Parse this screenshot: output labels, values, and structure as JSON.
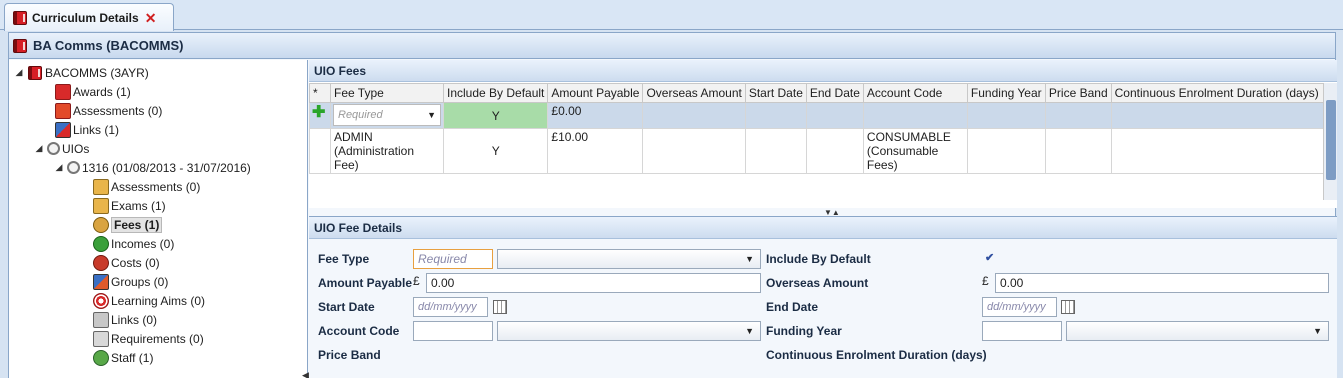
{
  "tab": {
    "title": "Curriculum Details",
    "close": "✕"
  },
  "header": {
    "title": "BA Comms (BACOMMS)"
  },
  "tree": {
    "root": "BACOMMS (3AYR)",
    "awards": "Awards (1)",
    "assessments": "Assessments (0)",
    "links": "Links (1)",
    "uios": "UIOs",
    "uio": "1316 (01/08/2013 - 31/07/2016)",
    "uio_children": [
      {
        "label": "Assessments (0)",
        "icon": "assessments-icon"
      },
      {
        "label": "Exams (1)",
        "icon": "exams-icon"
      },
      {
        "label": "Fees (1)",
        "icon": "fees-icon"
      },
      {
        "label": "Incomes (0)",
        "icon": "incomes-icon"
      },
      {
        "label": "Costs (0)",
        "icon": "costs-icon"
      },
      {
        "label": "Groups (0)",
        "icon": "groups-icon"
      },
      {
        "label": "Learning Aims (0)",
        "icon": "learning-aims-icon"
      },
      {
        "label": "Links (0)",
        "icon": "links-icon"
      },
      {
        "label": "Requirements (0)",
        "icon": "requirements-icon"
      },
      {
        "label": "Staff (1)",
        "icon": "staff-icon"
      }
    ]
  },
  "fees": {
    "title": "UIO Fees",
    "columns": [
      "*",
      "Fee Type",
      "Include By Default",
      "Amount Payable",
      "Overseas Amount",
      "Start Date",
      "End Date",
      "Account Code",
      "Funding Year",
      "Price Band",
      "Continuous Enrolment Duration (days)"
    ],
    "new_row": {
      "fee_type_placeholder": "Required",
      "include": "Y",
      "amount": "£0.00"
    },
    "rows": [
      {
        "fee_type_line1": "ADMIN",
        "fee_type_line2": "(Administration Fee)",
        "include": "Y",
        "amount": "£10.00",
        "account_line1": "CONSUMABLE",
        "account_line2": "(Consumable Fees)"
      }
    ]
  },
  "details": {
    "title": "UIO Fee Details",
    "fee_type_label": "Fee Type",
    "fee_type_placeholder": "Required",
    "include_label": "Include By Default",
    "include_checked": "✔",
    "amount_label": "Amount Payable",
    "amount_value": "0.00",
    "overseas_label": "Overseas Amount",
    "overseas_value": "0.00",
    "currency": "£",
    "start_label": "Start Date",
    "end_label": "End Date",
    "date_placeholder": "dd/mm/yyyy",
    "account_label": "Account Code",
    "funding_label": "Funding Year",
    "price_band_label": "Price Band",
    "ced_label": "Continuous Enrolment Duration (days)"
  },
  "colors": {
    "accent": "#8aa6c8",
    "header": "#cddcef",
    "new_row": "#cbd9ea",
    "include_default": "#a8dca8"
  }
}
